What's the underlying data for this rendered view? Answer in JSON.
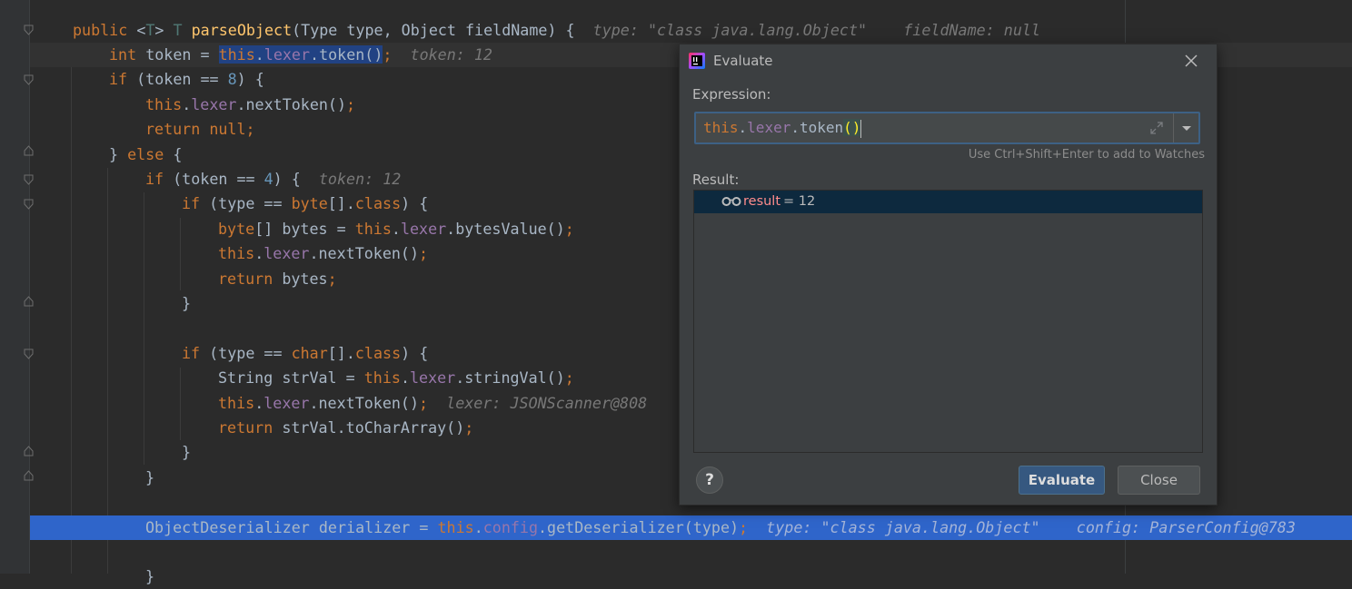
{
  "editor": {
    "lines": [
      {
        "indent": 0,
        "segments": [
          {
            "t": "public ",
            "c": "kw"
          },
          {
            "t": "<",
            "c": ""
          },
          {
            "t": "T",
            "c": "tp"
          },
          {
            "t": "> ",
            "c": ""
          },
          {
            "t": "T ",
            "c": "tp"
          },
          {
            "t": "parseObject",
            "c": "mth"
          },
          {
            "t": "(Type type, Object fieldName) {",
            "c": ""
          },
          {
            "t": "  type: \"class java.lang.Object\"    fieldName: null",
            "c": "hint"
          }
        ]
      },
      {
        "indent": 1,
        "state": "caret",
        "segments": [
          {
            "t": "int ",
            "c": "kw"
          },
          {
            "t": "token = ",
            "c": ""
          },
          {
            "t": "this",
            "c": "kw sel"
          },
          {
            "t": ".",
            "c": "sel"
          },
          {
            "t": "lexer",
            "c": "fld sel"
          },
          {
            "t": ".token()",
            "c": "sel"
          },
          {
            "t": ";",
            "c": "kw"
          },
          {
            "t": "  token: 12",
            "c": "hint"
          }
        ]
      },
      {
        "indent": 1,
        "segments": [
          {
            "t": "if ",
            "c": "kw"
          },
          {
            "t": "(token == ",
            "c": ""
          },
          {
            "t": "8",
            "c": "num"
          },
          {
            "t": ") {",
            "c": ""
          }
        ]
      },
      {
        "indent": 2,
        "segments": [
          {
            "t": "this",
            "c": "kw"
          },
          {
            "t": ".",
            "c": ""
          },
          {
            "t": "lexer",
            "c": "fld"
          },
          {
            "t": ".nextToken()",
            "c": ""
          },
          {
            "t": ";",
            "c": "kw"
          }
        ]
      },
      {
        "indent": 2,
        "segments": [
          {
            "t": "return null;",
            "c": "kw"
          }
        ]
      },
      {
        "indent": 1,
        "segments": [
          {
            "t": "} ",
            "c": ""
          },
          {
            "t": "else ",
            "c": "kw"
          },
          {
            "t": "{",
            "c": ""
          }
        ]
      },
      {
        "indent": 2,
        "segments": [
          {
            "t": "if ",
            "c": "kw"
          },
          {
            "t": "(token == ",
            "c": ""
          },
          {
            "t": "4",
            "c": "num"
          },
          {
            "t": ") {",
            "c": ""
          },
          {
            "t": "  token: 12",
            "c": "hint"
          }
        ]
      },
      {
        "indent": 3,
        "segments": [
          {
            "t": "if ",
            "c": "kw"
          },
          {
            "t": "(type == ",
            "c": ""
          },
          {
            "t": "byte",
            "c": "kw"
          },
          {
            "t": "[].",
            "c": ""
          },
          {
            "t": "class",
            "c": "kw"
          },
          {
            "t": ") {",
            "c": ""
          }
        ]
      },
      {
        "indent": 4,
        "segments": [
          {
            "t": "byte",
            "c": "kw"
          },
          {
            "t": "[] bytes = ",
            "c": ""
          },
          {
            "t": "this",
            "c": "kw"
          },
          {
            "t": ".",
            "c": ""
          },
          {
            "t": "lexer",
            "c": "fld"
          },
          {
            "t": ".bytesValue()",
            "c": ""
          },
          {
            "t": ";",
            "c": "kw"
          }
        ]
      },
      {
        "indent": 4,
        "segments": [
          {
            "t": "this",
            "c": "kw"
          },
          {
            "t": ".",
            "c": ""
          },
          {
            "t": "lexer",
            "c": "fld"
          },
          {
            "t": ".nextToken()",
            "c": ""
          },
          {
            "t": ";",
            "c": "kw"
          }
        ]
      },
      {
        "indent": 4,
        "segments": [
          {
            "t": "return ",
            "c": "kw"
          },
          {
            "t": "bytes",
            "c": ""
          },
          {
            "t": ";",
            "c": "kw"
          }
        ]
      },
      {
        "indent": 3,
        "segments": [
          {
            "t": "}",
            "c": ""
          }
        ]
      },
      {
        "indent": 0,
        "segments": []
      },
      {
        "indent": 3,
        "segments": [
          {
            "t": "if ",
            "c": "kw"
          },
          {
            "t": "(type == ",
            "c": ""
          },
          {
            "t": "char",
            "c": "kw"
          },
          {
            "t": "[].",
            "c": ""
          },
          {
            "t": "class",
            "c": "kw"
          },
          {
            "t": ") {",
            "c": ""
          }
        ]
      },
      {
        "indent": 4,
        "segments": [
          {
            "t": "String strVal = ",
            "c": ""
          },
          {
            "t": "this",
            "c": "kw"
          },
          {
            "t": ".",
            "c": ""
          },
          {
            "t": "lexer",
            "c": "fld"
          },
          {
            "t": ".stringVal()",
            "c": ""
          },
          {
            "t": ";",
            "c": "kw"
          }
        ]
      },
      {
        "indent": 4,
        "segments": [
          {
            "t": "this",
            "c": "kw"
          },
          {
            "t": ".",
            "c": ""
          },
          {
            "t": "lexer",
            "c": "fld"
          },
          {
            "t": ".nextToken()",
            "c": ""
          },
          {
            "t": ";",
            "c": "kw"
          },
          {
            "t": "  lexer: JSONScanner@808",
            "c": "hint"
          }
        ]
      },
      {
        "indent": 4,
        "segments": [
          {
            "t": "return ",
            "c": "kw"
          },
          {
            "t": "strVal.toCharArray()",
            "c": ""
          },
          {
            "t": ";",
            "c": "kw"
          }
        ]
      },
      {
        "indent": 3,
        "segments": [
          {
            "t": "}",
            "c": ""
          }
        ]
      },
      {
        "indent": 2,
        "segments": [
          {
            "t": "}",
            "c": ""
          }
        ]
      },
      {
        "indent": 0,
        "segments": []
      },
      {
        "indent": 2,
        "state": "exec",
        "segments": [
          {
            "t": "ObjectDeserializer derializer = ",
            "c": ""
          },
          {
            "t": "this",
            "c": "kw"
          },
          {
            "t": ".",
            "c": ""
          },
          {
            "t": "config",
            "c": "fld"
          },
          {
            "t": ".getDeserializer(type)",
            "c": ""
          },
          {
            "t": ";",
            "c": "kw"
          },
          {
            "t": "  type: \"class java.lang.Object\"    config: ParserConfig@783",
            "c": "hint"
          }
        ]
      },
      {
        "indent": 0,
        "segments": []
      },
      {
        "indent": 2,
        "segments": [
          {
            "t": "}",
            "c": ""
          }
        ]
      }
    ]
  },
  "dialog": {
    "title": "Evaluate",
    "expression_label": "Expression:",
    "expression": {
      "this_kw": "this",
      "dot1": ".",
      "field": "lexer",
      "rest": ".token",
      "parens": "()"
    },
    "shortcut_hint": "Use Ctrl+Shift+Enter to add to Watches",
    "result_label": "Result:",
    "result": {
      "name": "result",
      "value": " = 12"
    },
    "help_label": "?",
    "evaluate_button": "Evaluate",
    "close_button": "Close",
    "icons": {
      "app": "intellij-icon",
      "close": "close-icon",
      "expand": "expand-icon",
      "dropdown": "chevron-down-icon",
      "watch": "glasses-icon"
    }
  },
  "colors": {
    "exec_line": "#2f65ca",
    "keyword": "#cc7832",
    "field": "#9876aa",
    "method": "#ffc66d",
    "number": "#6897bb"
  }
}
